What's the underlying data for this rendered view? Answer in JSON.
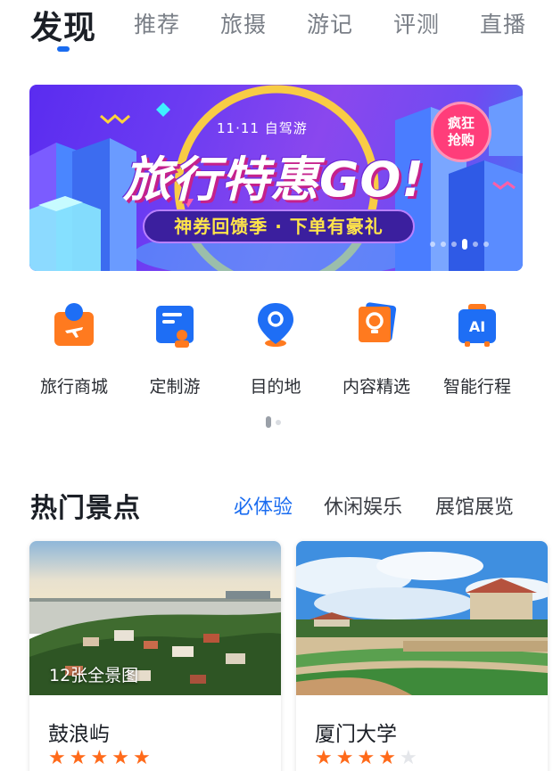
{
  "top_tabs": [
    {
      "label": "发现",
      "active": true
    },
    {
      "label": "推荐",
      "active": false
    },
    {
      "label": "旅摄",
      "active": false
    },
    {
      "label": "游记",
      "active": false
    },
    {
      "label": "评测",
      "active": false
    },
    {
      "label": "直播",
      "active": false
    }
  ],
  "banner": {
    "subtitle": "11·11  自驾游",
    "headline": "旅行特惠GO!",
    "slogan": "神券回馈季 · 下单有豪礼",
    "badge": "疯狂\n抢购",
    "slide_count": 6,
    "active_slide": 3
  },
  "shortcuts": [
    {
      "label": "旅行商城",
      "icon": "shopping-bag-plane-icon",
      "color": "#ff7a1f"
    },
    {
      "label": "定制游",
      "icon": "custom-trip-card-icon",
      "color": "#1e6ef5"
    },
    {
      "label": "目的地",
      "icon": "location-pin-icon",
      "color": "#1e6ef5"
    },
    {
      "label": "内容精选",
      "icon": "lightbulb-card-icon",
      "color": "#ff7a1f"
    },
    {
      "label": "智能行程",
      "icon": "ai-suitcase-icon",
      "color": "#1e6ef5"
    }
  ],
  "section": {
    "title": "热门景点",
    "tabs": [
      {
        "label": "必体验",
        "active": true
      },
      {
        "label": "休闲娱乐",
        "active": false
      },
      {
        "label": "展馆展览",
        "active": false
      }
    ]
  },
  "cards": [
    {
      "name": "鼓浪屿",
      "overlay": "12张全景图",
      "rating": 5
    },
    {
      "name": "厦门大学",
      "overlay": "",
      "rating": 4
    }
  ],
  "colors": {
    "accent": "#1a6cf0",
    "star": "#ff6a1a",
    "star_off": "#e4e6ea"
  }
}
